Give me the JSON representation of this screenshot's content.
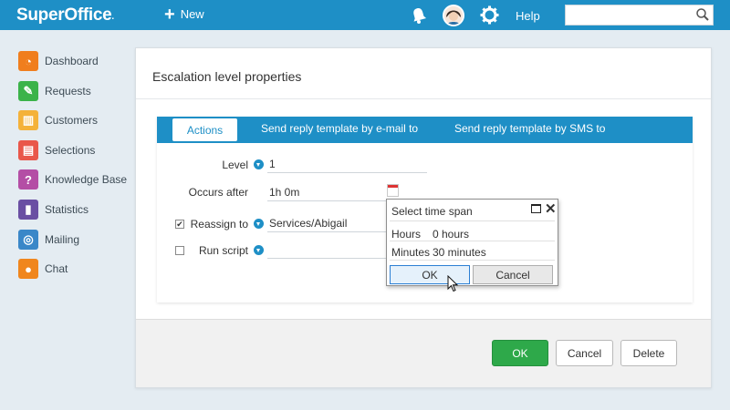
{
  "app": {
    "logo": "SuperOffice",
    "logo_mark": ".",
    "new_label": "New",
    "help_label": "Help",
    "search_value": ""
  },
  "sidebar": {
    "items": [
      {
        "label": "Dashboard",
        "icon": "dashboard-icon",
        "color": "#f07e1e"
      },
      {
        "label": "Requests",
        "icon": "requests-icon",
        "color": "#3bb34a"
      },
      {
        "label": "Customers",
        "icon": "customers-icon",
        "color": "#f4b23a"
      },
      {
        "label": "Selections",
        "icon": "selections-icon",
        "color": "#e9574a"
      },
      {
        "label": "Knowledge Base",
        "icon": "knowledge-base-icon",
        "color": "#b44ea5"
      },
      {
        "label": "Statistics",
        "icon": "statistics-icon",
        "color": "#6a4fa3"
      },
      {
        "label": "Mailing",
        "icon": "mailing-icon",
        "color": "#3a87c8"
      },
      {
        "label": "Chat",
        "icon": "chat-icon",
        "color": "#f0861d"
      }
    ]
  },
  "dialog": {
    "title": "Escalation level properties",
    "tabs": [
      {
        "label": "Actions"
      },
      {
        "label": "Send reply template by e-mail to"
      },
      {
        "label": "Send reply template by SMS to"
      }
    ],
    "fields": {
      "level_label": "Level",
      "level_value": "1",
      "occurs_after_label": "Occurs after",
      "occurs_after_value": "1h 0m",
      "reassign_label": "Reassign to",
      "reassign_value": "Services/Abigail",
      "reassign_checked": "✔",
      "run_script_label": "Run script",
      "run_script_value": ""
    },
    "buttons": {
      "ok": "OK",
      "cancel": "Cancel",
      "delete": "Delete"
    }
  },
  "popup": {
    "title": "Select time span",
    "hours_label": "Hours",
    "hours_value": "0 hours",
    "minutes_label": "Minutes",
    "minutes_value": "30 minutes",
    "ok_label": "OK",
    "cancel_label": "Cancel",
    "close_glyph": "✕"
  },
  "colors": {
    "brand": "#1e8fc6",
    "ok_button": "#2ea94a"
  }
}
